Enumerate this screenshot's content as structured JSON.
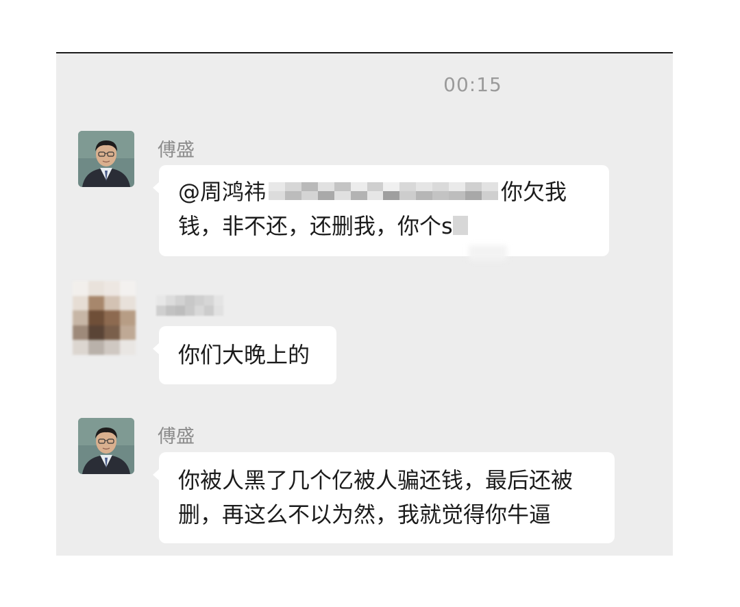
{
  "chat": {
    "timestamp": "00:15",
    "messages": [
      {
        "sender": "傅盛",
        "lines": [
          "@周鸿祎",
          "你欠我",
          "钱，非不还，还删我，你个s"
        ]
      },
      {
        "sender": "",
        "lines": [
          "你们大晚上的"
        ]
      },
      {
        "sender": "傅盛",
        "lines": [
          "你被人黑了几个亿被人骗还钱，最后还被",
          "删，再这么不以为然，我就觉得你牛逼"
        ]
      }
    ]
  },
  "colors": {
    "background": "#ededed",
    "bubble": "#ffffff",
    "name_text": "#8c8c8c",
    "timestamp_text": "#9a9a9a",
    "message_text": "#1b1b1b"
  },
  "icons": {
    "avatar_1": "person-portrait-avatar",
    "avatar_2": "pixelated-avatar",
    "avatar_3": "person-portrait-avatar"
  }
}
